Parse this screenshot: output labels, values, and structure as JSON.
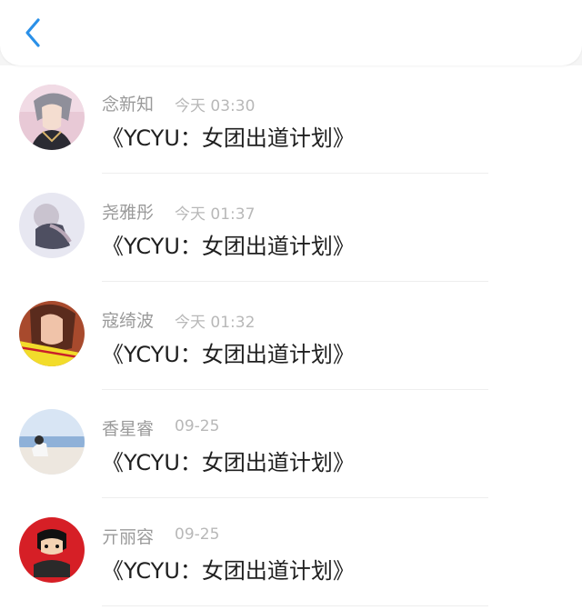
{
  "header": {
    "back_icon": "chevron-left-icon"
  },
  "colors": {
    "accent": "#2a90e8",
    "name_text": "#9a9a9a",
    "time_text": "#b8b8b8",
    "message_text": "#1f1f1f"
  },
  "messages": [
    {
      "name": "念新知",
      "time": "今天 03:30",
      "text": "《YCYU：女团出道计划》"
    },
    {
      "name": "尧雅彤",
      "time": "今天 01:37",
      "text": "《YCYU：女团出道计划》"
    },
    {
      "name": "寇绮波",
      "time": "今天 01:32",
      "text": "《YCYU：女团出道计划》"
    },
    {
      "name": "香星睿",
      "time": "09-25",
      "text": "《YCYU：女团出道计划》"
    },
    {
      "name": "亓丽容",
      "time": "09-25",
      "text": "《YCYU：女团出道计划》"
    }
  ]
}
